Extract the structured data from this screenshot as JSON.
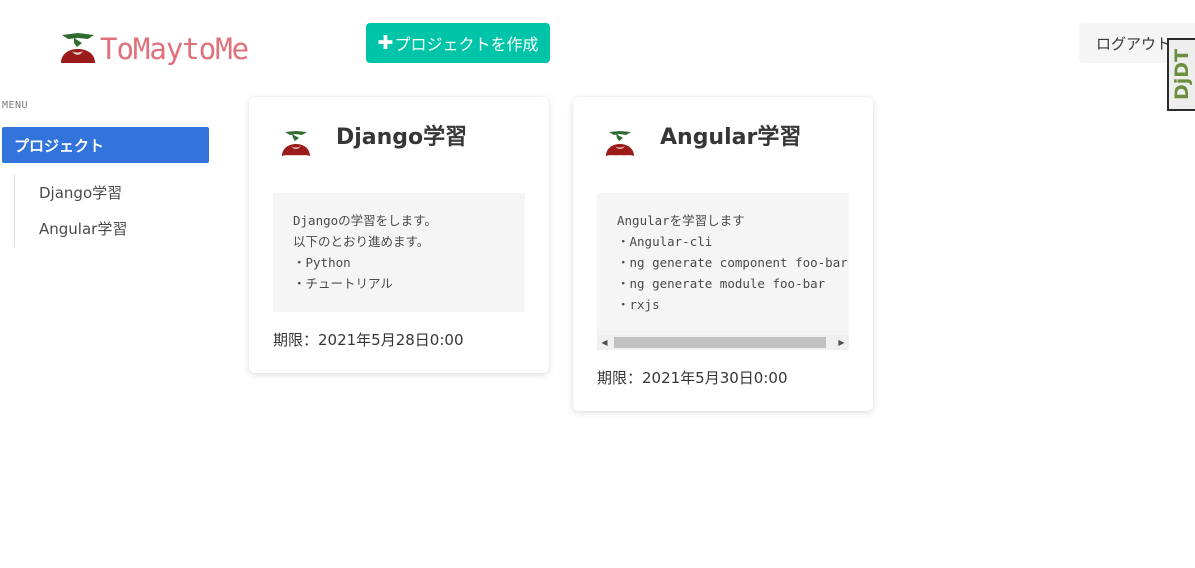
{
  "header": {
    "logo_text": "ToMaytoMe",
    "create_button_plus": "✚",
    "create_button_label": "プロジェクトを作成",
    "logout_label": "ログアウト",
    "debug_toolbar_label": "DjDT"
  },
  "sidebar": {
    "menu_label": "MENU",
    "active_item": "プロジェクト",
    "items": [
      {
        "label": "Django学習"
      },
      {
        "label": "Angular学習"
      }
    ]
  },
  "projects": [
    {
      "title": "Django学習",
      "description": "Djangoの学習をします。\n以下のとおり進めます。\n・Python\n・チュートリアル",
      "deadline": "期限：2021年5月28日0:00"
    },
    {
      "title": "Angular学習",
      "description": "Angularを学習します\n・Angular-cli\n・ng generate component foo-bar\n・ng generate module foo-bar\n・rxjs",
      "deadline": "期限：2021年5月30日0:00"
    }
  ],
  "colors": {
    "primary": "#3273dc",
    "accent": "#00c4a7",
    "logo": "#e0707a",
    "tomato_red": "#9b1b1b",
    "leaf_green": "#2e6b2e"
  },
  "icons": {
    "logo": "tomato-icon",
    "project": "tomato-icon"
  }
}
